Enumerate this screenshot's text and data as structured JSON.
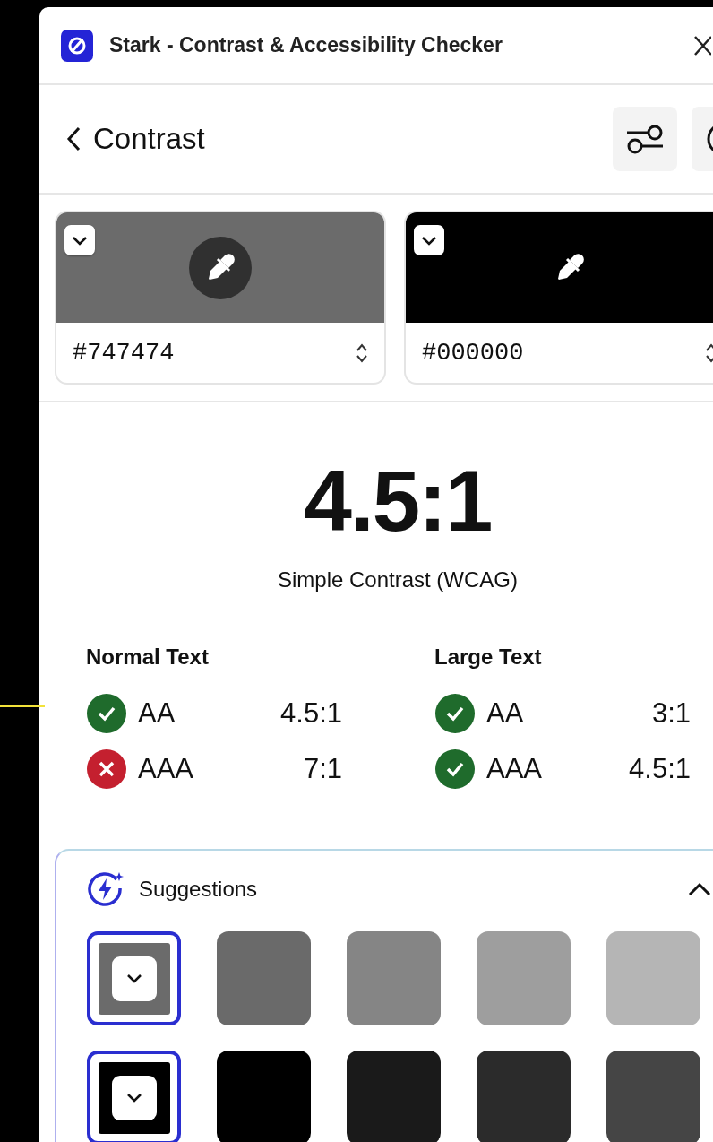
{
  "window": {
    "title": "Stark - Contrast & Accessibility Checker"
  },
  "header": {
    "title": "Contrast"
  },
  "colors": [
    {
      "value": "#747474",
      "color": "#6b6b6b"
    },
    {
      "value": "#000000",
      "color": "#000000"
    }
  ],
  "ratio": {
    "value": "4.5:1",
    "label": "Simple Contrast (WCAG)"
  },
  "results": [
    {
      "title": "Normal Text",
      "levels": [
        {
          "label": "AA",
          "ratio": "4.5:1",
          "pass": true
        },
        {
          "label": "AAA",
          "ratio": "7:1",
          "pass": false
        }
      ]
    },
    {
      "title": "Large Text",
      "levels": [
        {
          "label": "AA",
          "ratio": "3:1",
          "pass": true
        },
        {
          "label": "AAA",
          "ratio": "4.5:1",
          "pass": true
        }
      ]
    }
  ],
  "suggestions": {
    "title": "Suggestions",
    "expanded": true,
    "rows": [
      {
        "swatches": [
          {
            "color": "#6b6b6b",
            "selected": true
          },
          {
            "color": "#6a6a6a",
            "selected": false
          },
          {
            "color": "#858585",
            "selected": false
          },
          {
            "color": "#9e9e9e",
            "selected": false
          },
          {
            "color": "#b5b5b5",
            "selected": false
          }
        ]
      },
      {
        "swatches": [
          {
            "color": "#000000",
            "selected": true
          },
          {
            "color": "#000000",
            "selected": false
          },
          {
            "color": "#1a1a1a",
            "selected": false
          },
          {
            "color": "#2b2b2b",
            "selected": false
          },
          {
            "color": "#454545",
            "selected": false
          }
        ]
      }
    ]
  }
}
